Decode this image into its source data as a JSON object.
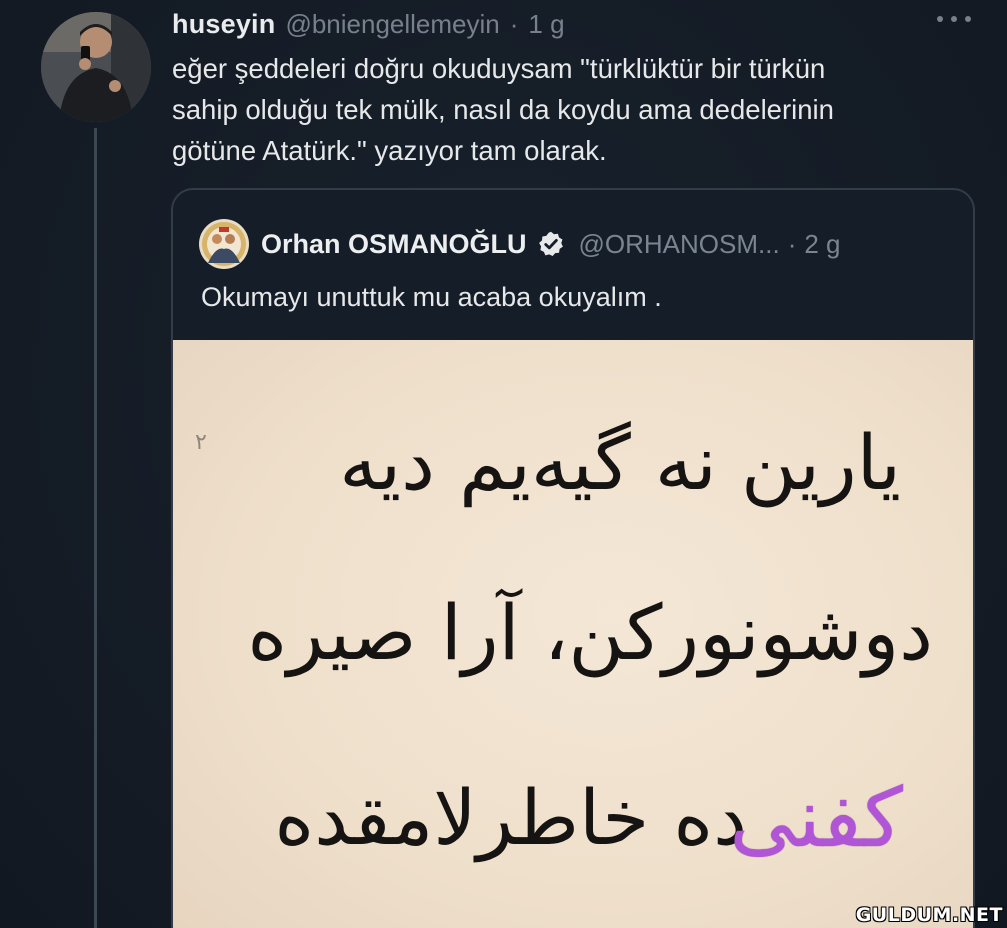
{
  "tweet": {
    "author": {
      "display_name": "huseyin",
      "handle": "@bniengellemeyin",
      "separator": "·",
      "time": "1 g"
    },
    "text": "eğer şeddeleri doğru okuduysam \"türklüktür bir türkün\nsahip olduğu tek mülk, nasıl da koydu ama dedelerinin\ngötüne Atatürk.\" yazıyor tam olarak.",
    "icons": {
      "avatar": "profile-photo",
      "more": "more-horizontal-icon"
    }
  },
  "quote": {
    "author": {
      "display_name": "Orhan OSMANOĞLU",
      "handle": "@ORHANOSM...",
      "separator": "·",
      "time": "2 g",
      "verified": true
    },
    "text": "Okumayı unuttuk mu acaba okuyalım .",
    "media": {
      "line1": "یارین نه گیه‌یم دیه",
      "line2": "دوشونورکن، آرا صیره",
      "line3": "ده خاطرلامقده",
      "highlight": "کفنی",
      "mark": "۲",
      "highlight_color": "#b055d6"
    }
  },
  "watermark": "GULDUM.NET",
  "colors": {
    "background": "#151d28",
    "text": "#e7e9ea",
    "muted": "#76818c",
    "verified": "#e7e9ea"
  }
}
